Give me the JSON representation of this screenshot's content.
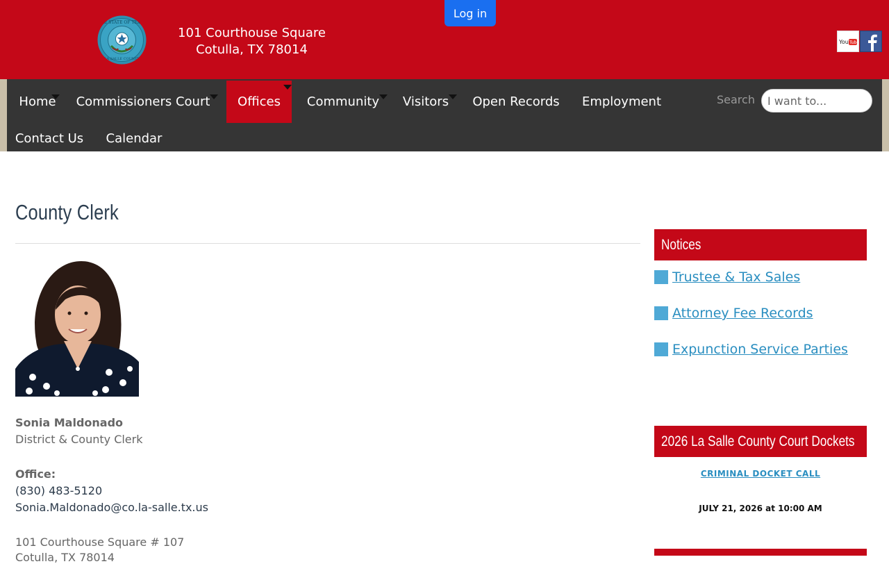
{
  "header": {
    "address_line1": "101 Courthouse Square",
    "address_line2": "Cotulla, TX 78014",
    "login_label": "Log in",
    "seal_text_top": "THE STATE OF TEXAS",
    "seal_text_bottom": "LA SALLE COUNTY",
    "youtube_icon": "youtube-icon",
    "facebook_icon": "facebook-icon"
  },
  "nav": {
    "items": [
      {
        "label": "Home",
        "has_dropdown": true
      },
      {
        "label": "Commissioners Court",
        "has_dropdown": true
      },
      {
        "label": "Offices",
        "has_dropdown": true,
        "active": true
      },
      {
        "label": "Community",
        "has_dropdown": true
      },
      {
        "label": "Visitors",
        "has_dropdown": true
      },
      {
        "label": "Open Records",
        "has_dropdown": false
      },
      {
        "label": "Employment",
        "has_dropdown": false
      },
      {
        "label": "Contact Us",
        "has_dropdown": false
      },
      {
        "label": "Calendar",
        "has_dropdown": false
      }
    ],
    "search_label": "Search",
    "search_placeholder": "I want to..."
  },
  "main": {
    "title": "County Clerk",
    "name": "Sonia Maldonado",
    "role": "District & County Clerk",
    "office_label": "Office:",
    "phone": "(830) 483-5120",
    "email": "Sonia.Maldonado@co.la-salle.tx.us",
    "address_line1": "101 Courthouse Square # 107",
    "address_line2": "Cotulla, TX 78014"
  },
  "sidebar": {
    "notices_title": "Notices",
    "notices": [
      {
        "label": "Trustee & Tax Sales"
      },
      {
        "label": "Attorney Fee Records"
      },
      {
        "label": "Expunction Service Parties"
      }
    ],
    "dockets_title": "2026 La Salle County Court Dockets",
    "docket_link": "CRIMINAL DOCKET CALL",
    "docket_date": "JULY 21, 2026 at 10:00 AM"
  },
  "colors": {
    "brand_red": "#c40818",
    "nav_bg": "#353535",
    "link_blue": "#2a8ec0",
    "login_blue": "#1a6ff0"
  }
}
